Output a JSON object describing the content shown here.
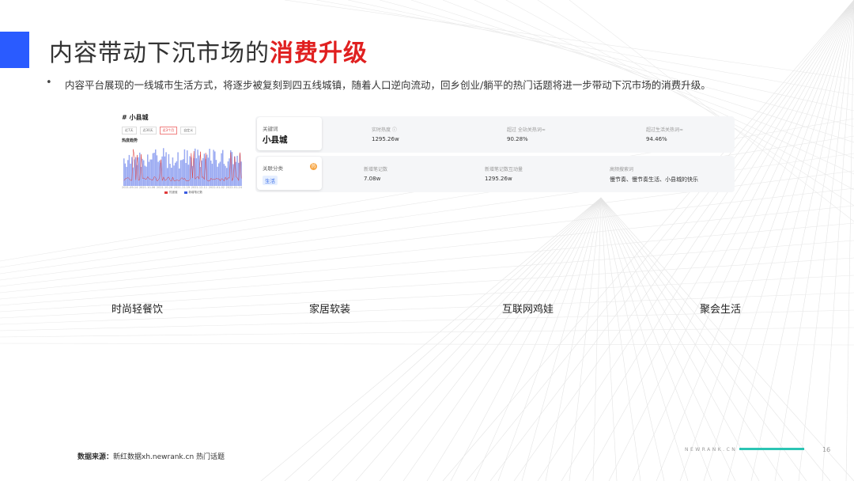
{
  "header": {
    "title_prefix": "内容带动下沉市场的",
    "title_highlight": "消费升级"
  },
  "description": {
    "bullet": "•",
    "text": "内容平台展现的一线城市生活方式，将逐步被复刻到四五线城镇，随着人口逆向流动，回乡创业/躺平的热门话题将进一步带动下沉市场的消费升级。"
  },
  "chart_card": {
    "title": "# 小县城",
    "tabs": [
      "近7天",
      "近30天",
      "近3个月",
      "自定义"
    ],
    "active_tab_index": 2,
    "metric_label": "热度趋势",
    "x_ticks": [
      "2021-09-14",
      "2021-10-06",
      "2021-10-28",
      "2021-11-19",
      "2021-12-11",
      "2022-01-02",
      "2022-01-24"
    ],
    "legend": [
      "热度值",
      "新增笔记数"
    ],
    "colors": {
      "heat": "#e03a3a",
      "notes": "#8c9ef5"
    }
  },
  "panel_1": {
    "key_label": "关键词",
    "key_value": "小县城",
    "stats": [
      {
        "label": "实时热度 ⓘ",
        "value": "1295.26w"
      },
      {
        "label": "超过 全站关热词≈",
        "value": "90.28%"
      },
      {
        "label": "超过生活关热词≈",
        "value": "94.46%"
      }
    ]
  },
  "panel_2": {
    "key_label": "关联分类",
    "key_tag": "生活",
    "badge": "热",
    "stats": [
      {
        "label": "新增笔记数",
        "value": "7.08w"
      },
      {
        "label": "新增笔记数互动量",
        "value": "1295.26w"
      },
      {
        "label": "高频搜索词",
        "value": "慢节奏、慢节奏生活、小县城的快乐"
      }
    ]
  },
  "categories": [
    "时尚轻餐饮",
    "家居软装",
    "互联网鸡娃",
    "聚会生活"
  ],
  "footer": {
    "source_label": "数据来源：",
    "source_text": "新红数据xh.newrank.cn 热门话题",
    "brand": "NEWRANK.CN",
    "page_number": "16",
    "accent_color": "#2bc4b4"
  }
}
